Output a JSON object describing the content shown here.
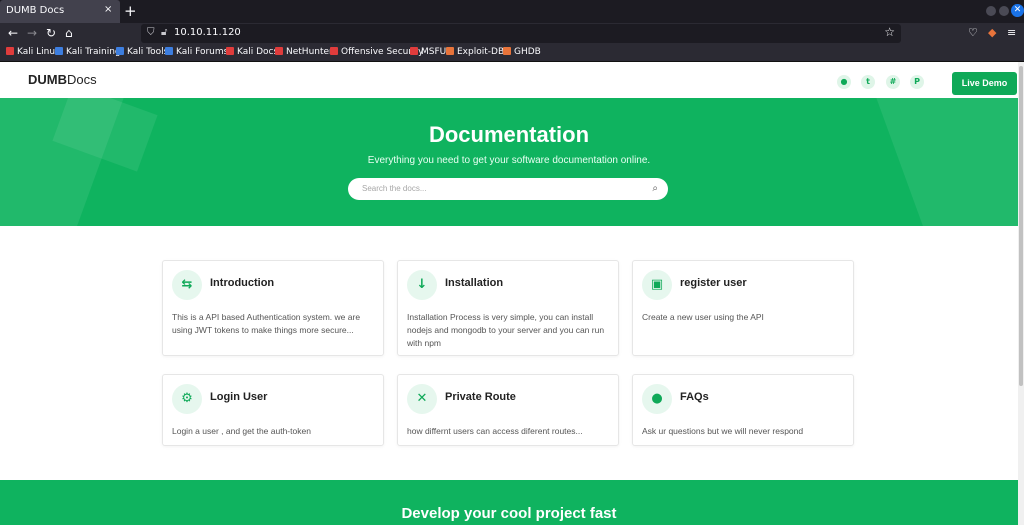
{
  "browser": {
    "tab_title": "DUMB Docs",
    "tab_close": "×",
    "new_tab": "+",
    "url": "10.10.11.120",
    "bookmarks": [
      {
        "label": "Kali Linux",
        "color": "#e03c3c"
      },
      {
        "label": "Kali Training",
        "color": "#3d7ee0"
      },
      {
        "label": "Kali Tools",
        "color": "#3d7ee0"
      },
      {
        "label": "Kali Forums",
        "color": "#3d7ee0"
      },
      {
        "label": "Kali Docs",
        "color": "#e03c3c"
      },
      {
        "label": "NetHunter",
        "color": "#e03c3c"
      },
      {
        "label": "Offensive Security",
        "color": "#e03c3c"
      },
      {
        "label": "MSFU",
        "color": "#e03c3c"
      },
      {
        "label": "Exploit-DB",
        "color": "#e8743b"
      },
      {
        "label": "GHDB",
        "color": "#e8743b"
      }
    ]
  },
  "header": {
    "logo_bold": "DUMB",
    "logo_light": "Docs",
    "social_icons": [
      "github-icon",
      "twitter-icon",
      "slack-icon",
      "producthunt-icon"
    ],
    "live_demo": "Live Demo"
  },
  "hero": {
    "title": "Documentation",
    "subtitle": "Everything you need to get your software documentation online.",
    "search_placeholder": "Search the docs..."
  },
  "cards": [
    {
      "title": "Introduction",
      "icon": "signpost-icon",
      "text": "This is a API based Authentication system. we are using JWT tokens to make things more secure..."
    },
    {
      "title": "Installation",
      "icon": "arrow-down-icon",
      "text": "Installation Process is very simple, you can install nodejs and mongodb to your server and you can run with npm"
    },
    {
      "title": "register user",
      "icon": "box-icon",
      "text": "Create a new user using the API"
    },
    {
      "title": "Login User",
      "icon": "cogs-icon",
      "text": "Login a user , and get the auth-token"
    },
    {
      "title": "Private Route",
      "icon": "tools-icon",
      "text": "how differnt users can access diferent routes..."
    },
    {
      "title": "FAQs",
      "icon": "lightbulb-icon",
      "text": "Ask ur questions but we will never respond"
    }
  ],
  "cta": {
    "title": "Develop your cool project fast"
  },
  "colors": {
    "brand": "#0fb35f",
    "button": "#0fa958"
  }
}
